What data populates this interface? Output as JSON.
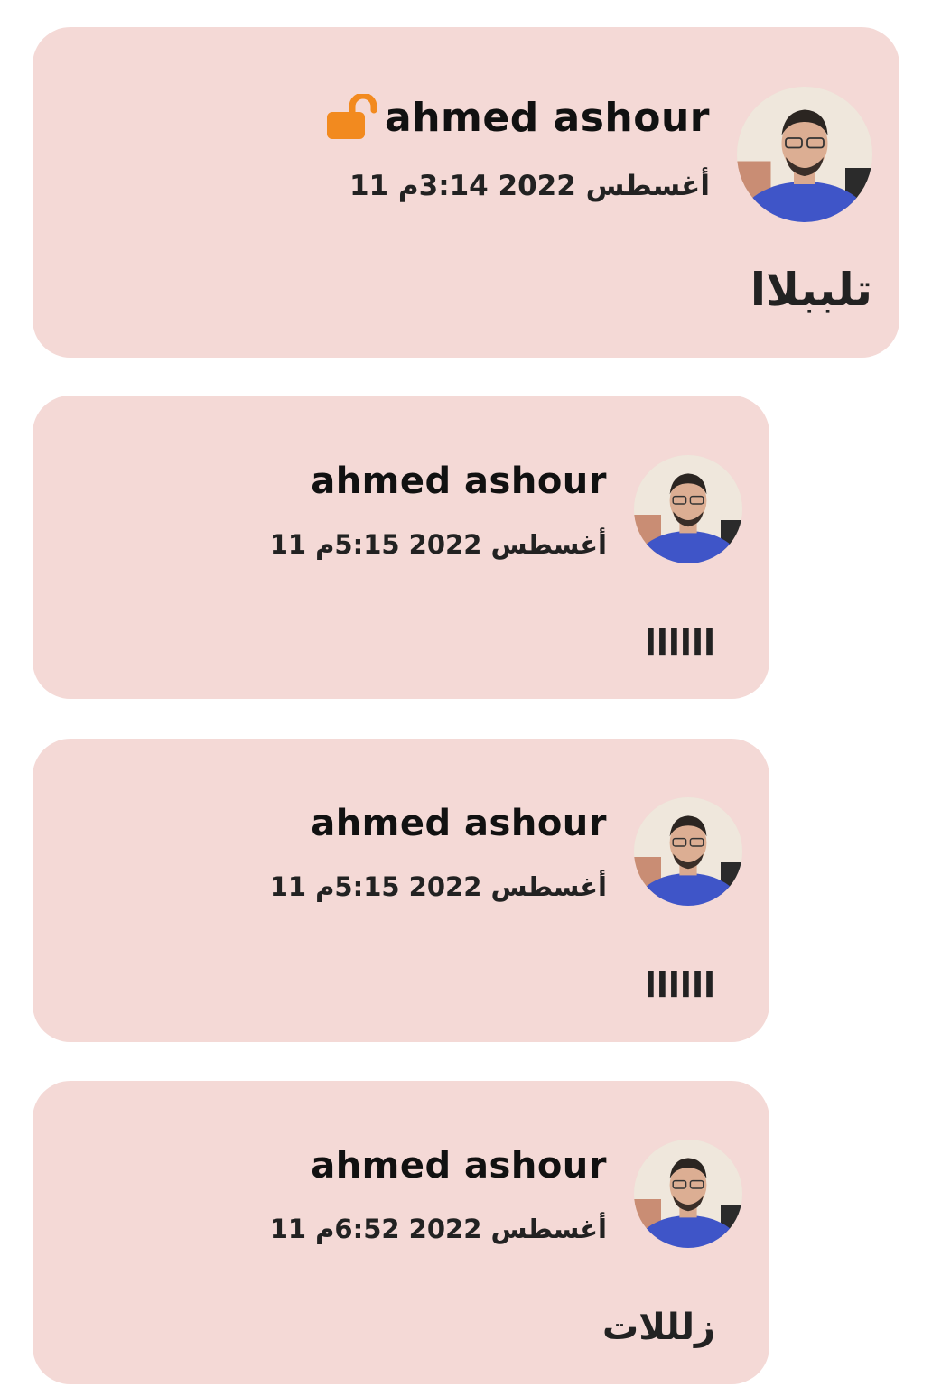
{
  "colors": {
    "card_background": "#f4d9d6",
    "lock_accent": "#f28a1f"
  },
  "posts": [
    {
      "author": "ahmed ashour",
      "date": "11 أغسطس 2022 3:14م",
      "text": "تلببلاا",
      "icon": "unlock-icon"
    },
    {
      "author": "ahmed ashour",
      "date": "11 أغسطس 2022 5:15م",
      "text": "llllll"
    },
    {
      "author": "ahmed ashour",
      "date": "11 أغسطس 2022 5:15م",
      "text": "llllll"
    },
    {
      "author": "ahmed ashour",
      "date": "11 أغسطس 2022 6:52م",
      "text": "زلللات"
    }
  ]
}
